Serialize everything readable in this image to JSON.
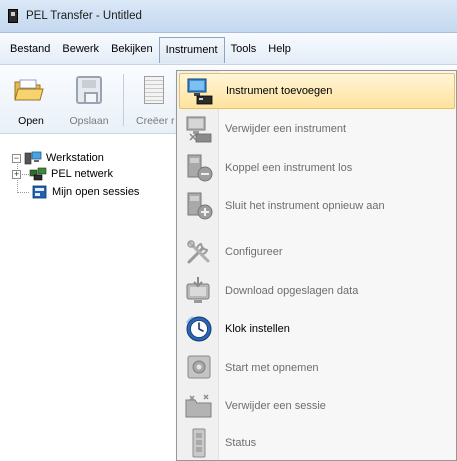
{
  "window": {
    "title": "PEL Transfer - Untitled"
  },
  "menubar": {
    "items": [
      {
        "label": "Bestand"
      },
      {
        "label": "Bewerk"
      },
      {
        "label": "Bekijken"
      },
      {
        "label": "Instrument"
      },
      {
        "label": "Tools"
      },
      {
        "label": "Help"
      }
    ]
  },
  "toolbar": {
    "open_label": "Open",
    "save_label": "Opslaan",
    "create_label": "Creëer r"
  },
  "tree": {
    "root_label": "Werkstation",
    "children": [
      {
        "label": "PEL netwerk"
      },
      {
        "label": "Mijn open sessies"
      }
    ]
  },
  "instrument_menu": {
    "items": [
      {
        "label": "Instrument toevoegen",
        "icon": "add-instrument-icon",
        "state": "highlighted"
      },
      {
        "label": "Verwijder een instrument",
        "icon": "remove-instrument-icon",
        "state": "disabled"
      },
      {
        "label": "Koppel een instrument los",
        "icon": "disconnect-instrument-icon",
        "state": "disabled"
      },
      {
        "label": "Sluit het instrument opnieuw aan",
        "icon": "reconnect-instrument-icon",
        "state": "disabled"
      },
      {
        "label": "Configureer",
        "icon": "tools-icon",
        "state": "disabled"
      },
      {
        "label": "Download opgeslagen data",
        "icon": "download-icon",
        "state": "disabled"
      },
      {
        "label": "Klok instellen",
        "icon": "clock-icon",
        "state": "enabled"
      },
      {
        "label": "Start met opnemen",
        "icon": "record-icon",
        "state": "disabled"
      },
      {
        "label": "Verwijder een sessie",
        "icon": "delete-session-icon",
        "state": "disabled"
      },
      {
        "label": "Status",
        "icon": "status-icon",
        "state": "disabled"
      }
    ]
  },
  "colors": {
    "highlight": "#ffe29e",
    "titlebar": "#c4d8ef"
  }
}
